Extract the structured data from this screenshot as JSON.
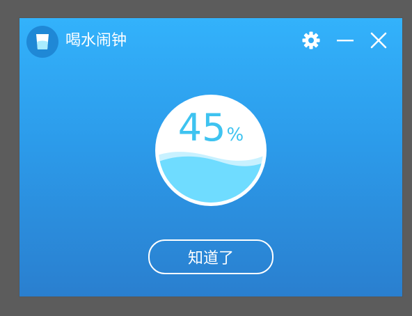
{
  "app": {
    "title": "喝水闹钟",
    "icon": "water-glass-icon"
  },
  "window_controls": {
    "settings_icon": "gear-icon",
    "minimize_icon": "minimize-icon",
    "close_icon": "close-icon"
  },
  "progress": {
    "value": 45,
    "value_text": "45",
    "unit": "%"
  },
  "actions": {
    "ok_label": "知道了"
  },
  "colors": {
    "background_top": "#33b2fb",
    "background_bottom": "#2a7fcf",
    "water": "#6fdcff",
    "percent_text": "#3ec3f0"
  }
}
